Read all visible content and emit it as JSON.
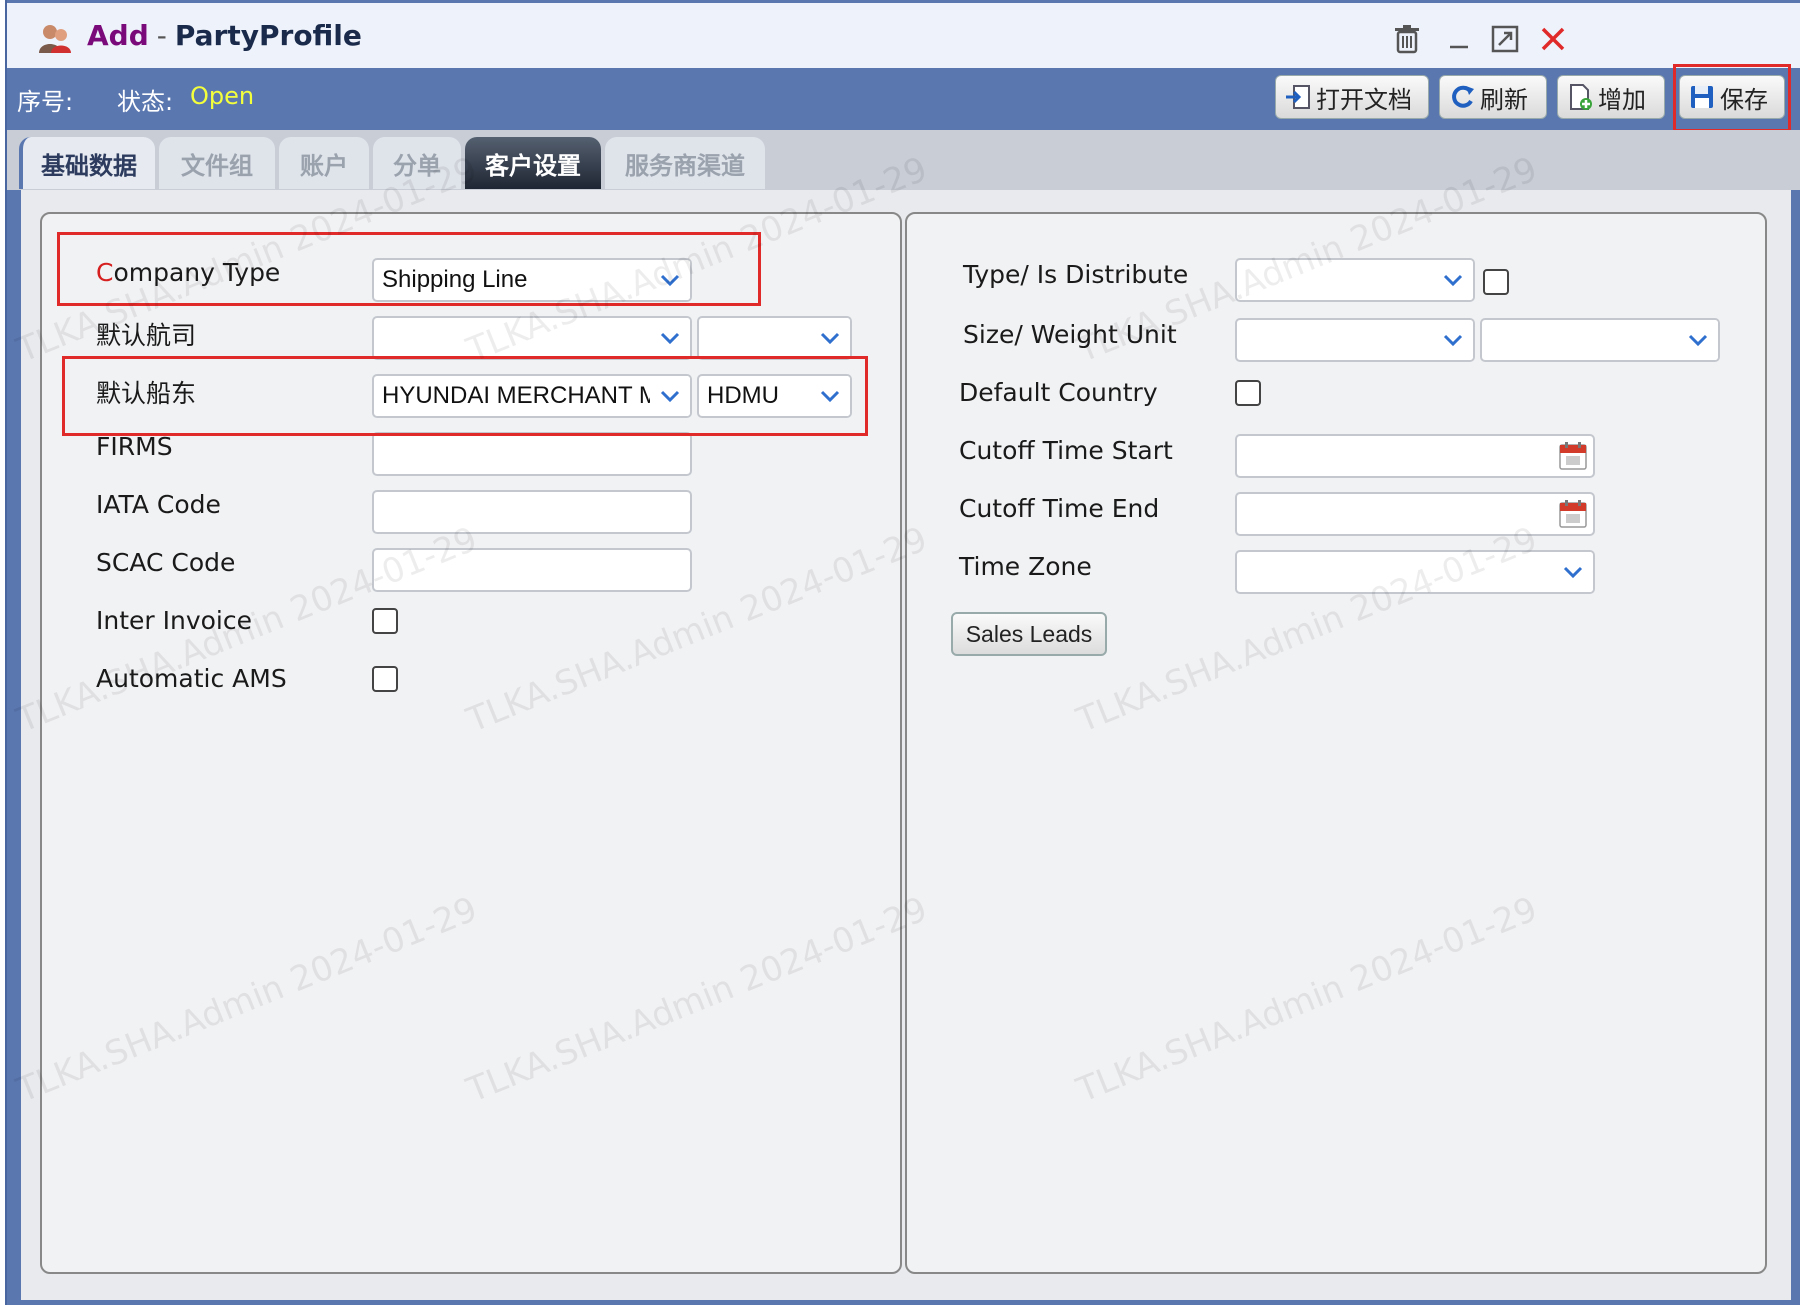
{
  "window": {
    "title_action": "Add",
    "title_separator": "-",
    "title_name": "PartyProfile",
    "controls": [
      "trash-icon",
      "minimize-icon",
      "maximize-icon",
      "close-icon"
    ]
  },
  "toolbar": {
    "seq_label": "序号:",
    "status_label": "状态:",
    "status_value": "Open",
    "buttons": {
      "open_doc": "打开文档",
      "refresh": "刷新",
      "add": "增加",
      "save": "保存"
    }
  },
  "tabs": [
    "基础数据",
    "文件组",
    "账户",
    "分单",
    "客户设置",
    "服务商渠道"
  ],
  "active_tab": "客户设置",
  "left": {
    "company_type_label_first": "C",
    "company_type_label_rest": "ompany Type",
    "company_type_value": "Shipping Line",
    "default_carrier_label": "默认航司",
    "default_carrier_value": "",
    "default_carrier_code": "",
    "default_owner_label": "默认船东",
    "default_owner_value": "HYUNDAI MERCHANT MARINE",
    "default_owner_code": "HDMU",
    "firms_label": "FIRMS",
    "firms_value": "",
    "iata_label": "IATA Code",
    "iata_value": "",
    "scac_label": "SCAC Code",
    "scac_value": "",
    "inter_invoice_label": "Inter Invoice",
    "automatic_ams_label": "Automatic AMS"
  },
  "right": {
    "type_distribute_label": "Type/ Is Distribute",
    "type_value": "",
    "size_weight_label": "Size/ Weight Unit",
    "size_value": "",
    "weight_value": "",
    "default_country_label": "Default Country",
    "cutoff_start_label": "Cutoff Time Start",
    "cutoff_start_value": "",
    "cutoff_end_label": "Cutoff Time End",
    "cutoff_end_value": "",
    "time_zone_label": "Time Zone",
    "time_zone_value": "",
    "sales_leads_label": "Sales Leads"
  },
  "watermark": "TLKA.SHA.Admin 2024-01-29",
  "colors": {
    "header_blue": "#5a77b0",
    "status_yellow": "#f4ff3c",
    "title_purple": "#7a0a7a",
    "highlight_red": "#e02a2a",
    "chevron_blue": "#2f6fce"
  }
}
